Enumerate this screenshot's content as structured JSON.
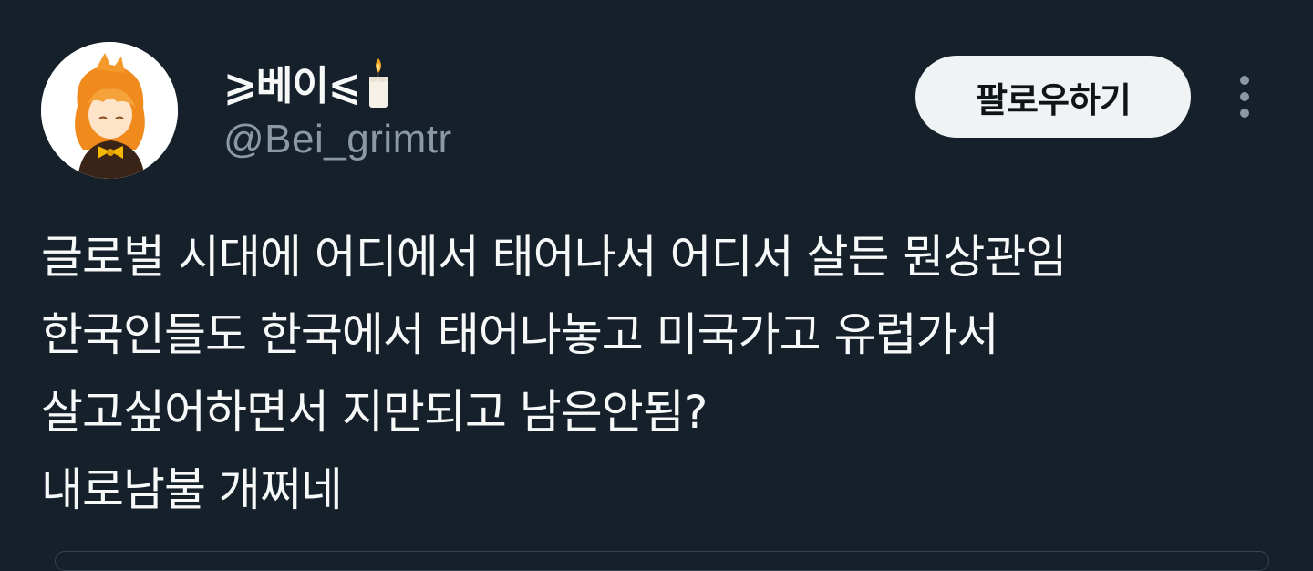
{
  "user": {
    "display_name": "⩾베이⩽",
    "handle": "@Bei_grimtr",
    "name_emoji": "candle-icon"
  },
  "actions": {
    "follow_label": "팔로우하기"
  },
  "tweet": {
    "lines": [
      "글로벌 시대에 어디에서 태어나서 어디서 살든 뭔상관임",
      "한국인들도 한국에서 태어나놓고 미국가고 유럽가서",
      "살고싶어하면서 지만되고 남은안됨?",
      "내로남불 개쩌네"
    ]
  },
  "colors": {
    "background": "#15202b",
    "text_primary": "#f7f9f9",
    "text_secondary": "#8b98a5",
    "button_bg": "#eff3f4",
    "button_text": "#0f1419"
  }
}
